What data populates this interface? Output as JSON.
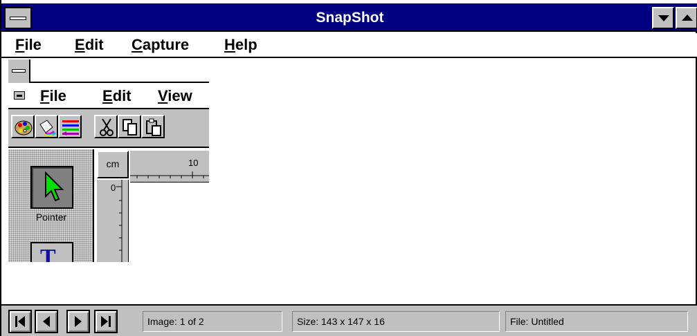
{
  "app": {
    "title": "SnapShot"
  },
  "menubar": {
    "items": [
      {
        "label": "File",
        "underline": "F",
        "rest": "ile"
      },
      {
        "label": "Edit",
        "underline": "E",
        "rest": "dit"
      },
      {
        "label": "Capture",
        "underline": "C",
        "rest": "apture"
      },
      {
        "label": "Help",
        "underline": "H",
        "rest": "elp"
      }
    ]
  },
  "captured_image": {
    "menu": [
      {
        "label": "File",
        "underline": "F",
        "rest": "ile"
      },
      {
        "label": "Edit",
        "underline": "E",
        "rest": "dit"
      },
      {
        "label": "View",
        "underline": "V",
        "rest": "iew"
      }
    ],
    "toolbar_icons": [
      "palette-icon",
      "paint-bucket-icon",
      "line-style-icon",
      "scissors-icon",
      "copy-icon",
      "paste-icon"
    ],
    "ruler_unit": "cm",
    "hruler_label": "10",
    "vruler_label": "0",
    "pointer_label": "Pointer",
    "text_tool_glyph": "T"
  },
  "status": {
    "image": "Image: 1 of 2",
    "size": "Size: 143 x 147 x 16",
    "file": "File: Untitled"
  },
  "colors": {
    "titlebar": "#000080",
    "chrome": "#c0c0c0",
    "pointer_arrow": "#00e000"
  }
}
